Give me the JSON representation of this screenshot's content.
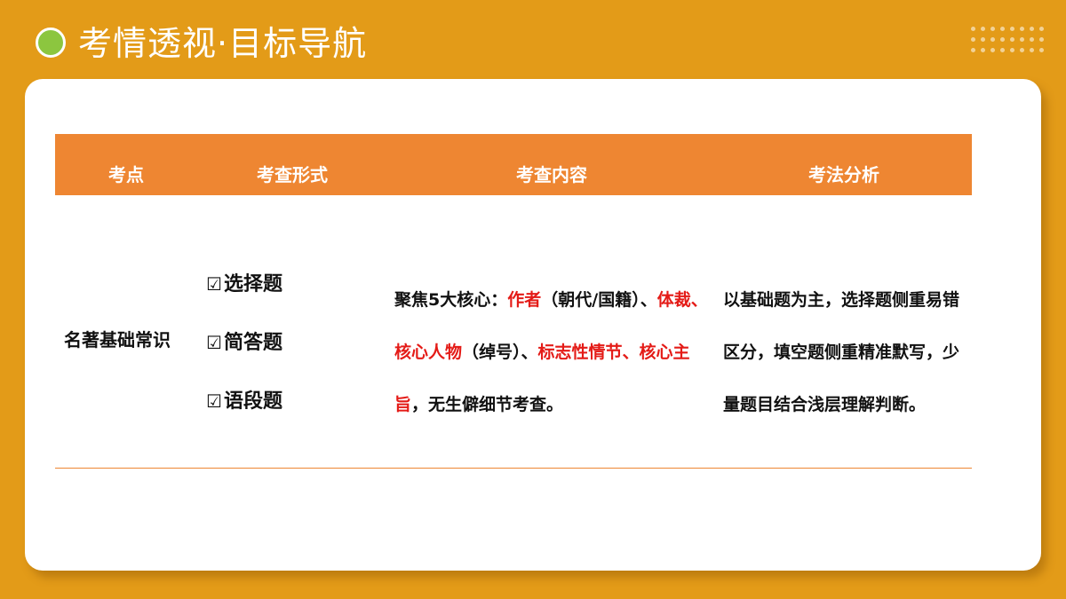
{
  "header": {
    "title": "考情透视·目标导航"
  },
  "table": {
    "columns": [
      "考点",
      "考查形式",
      "考查内容",
      "考法分析"
    ],
    "row": {
      "point": "名著基础常识",
      "check_mark": "☑",
      "forms": [
        "选择题",
        "简答题",
        "语段题"
      ],
      "content_segments": [
        {
          "text": "聚焦5大核心：",
          "red": false
        },
        {
          "text": "作者",
          "red": true
        },
        {
          "text": "（朝代/国籍）、",
          "red": false
        },
        {
          "text": "体裁、核心人物",
          "red": true
        },
        {
          "text": "（绰号）、",
          "red": false
        },
        {
          "text": "标志性情节、核心主旨",
          "red": true
        },
        {
          "text": "，无生僻细节考查。",
          "red": false
        }
      ],
      "analysis": "以基础题为主，选择题侧重易错区分，填空题侧重精准默写，少量题目结合浅层理解判断。"
    }
  },
  "colors": {
    "background": "#E39B18",
    "header_bar": "#EE8632",
    "accent_red": "#E41B17",
    "dot_green": "#8CC63F"
  }
}
